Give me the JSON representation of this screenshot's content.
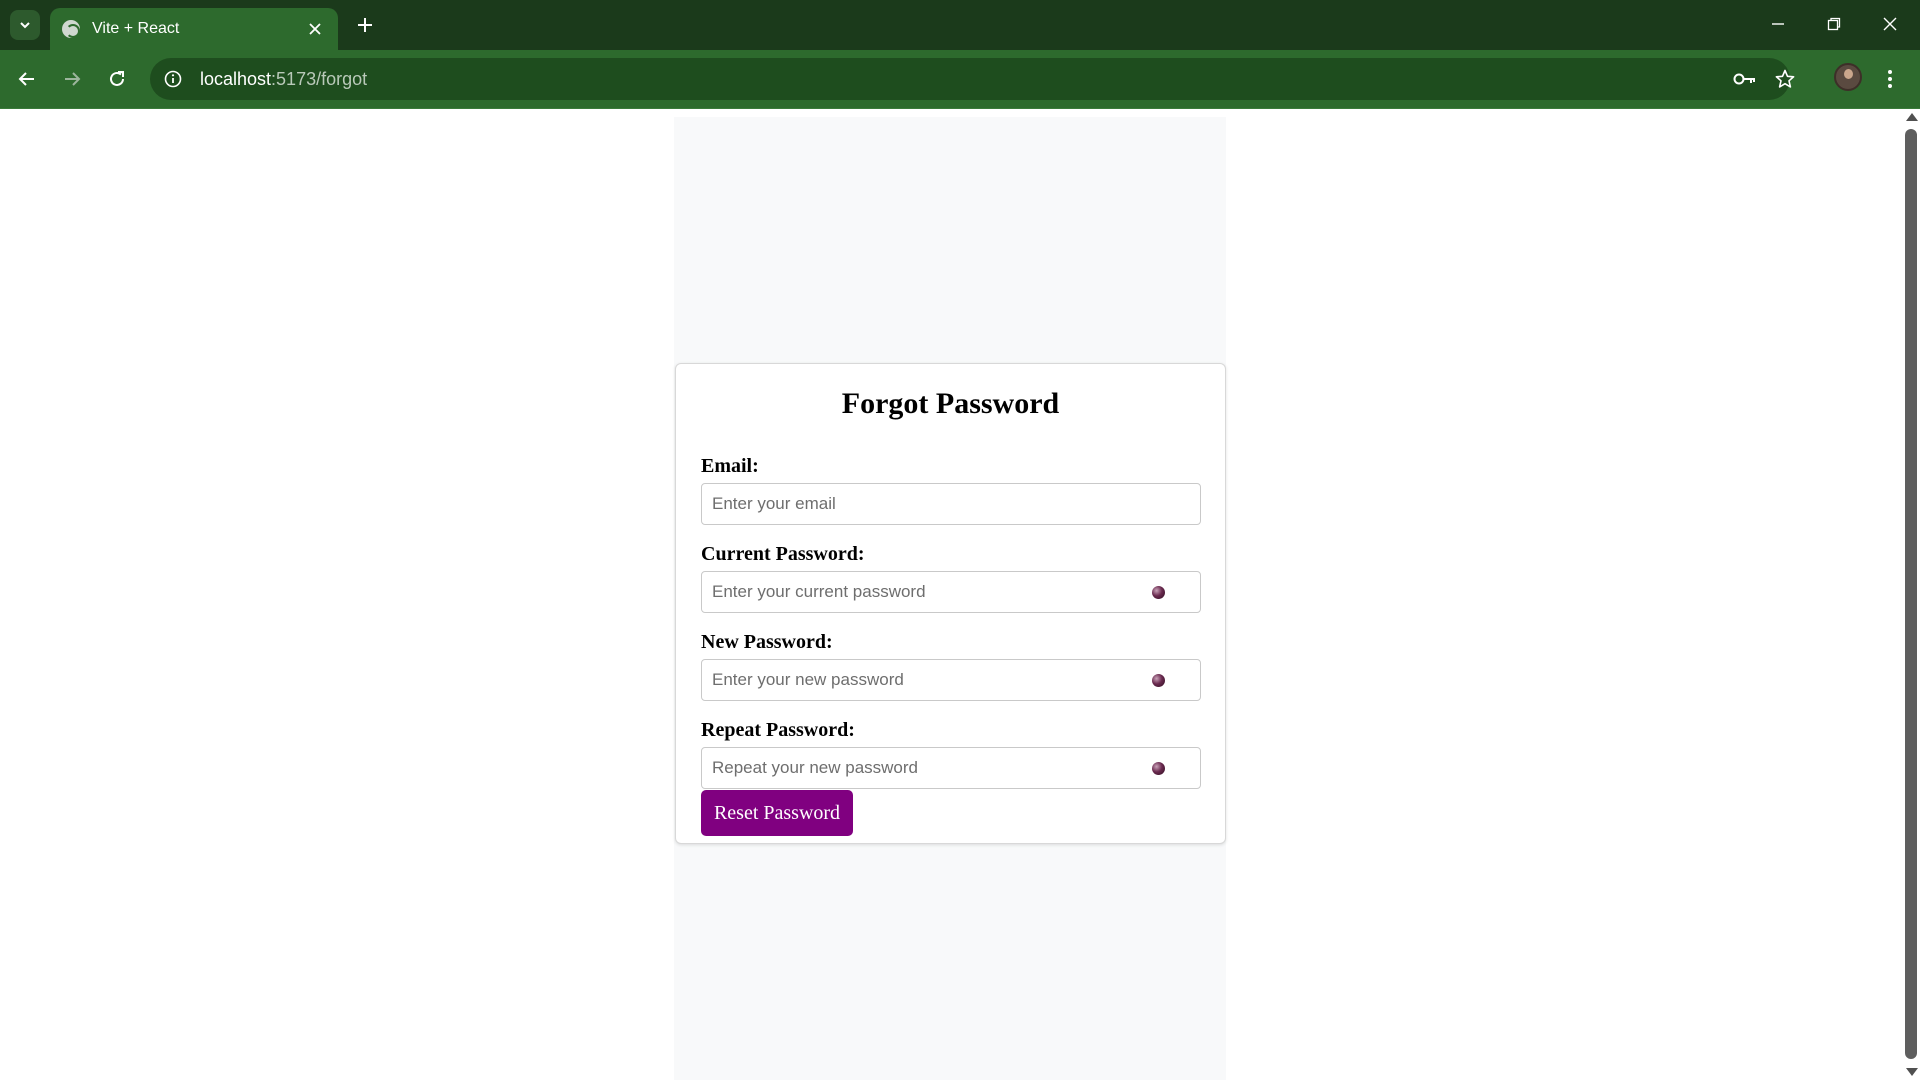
{
  "browser": {
    "tab_title": "Vite + React",
    "url_host": "localhost",
    "url_path": ":5173/forgot",
    "icons": {
      "tab_search": "chevron-down-icon",
      "favicon": "globe-icon",
      "tab_close": "close-icon",
      "new_tab": "plus-icon",
      "minimize": "minimize-icon",
      "restore": "restore-icon",
      "close": "close-icon",
      "back": "arrow-left-icon",
      "forward": "arrow-right-icon",
      "reload": "reload-icon",
      "site_info": "info-icon",
      "password_key": "key-icon",
      "bookmark": "star-icon",
      "profile": "avatar",
      "menu": "kebab-menu-icon"
    },
    "colors": {
      "tabstrip": "#1b3a1b",
      "toolbar": "#2d6a2d",
      "omnibox": "#1e4d1e"
    }
  },
  "form": {
    "title": "Forgot Password",
    "email_label": "Email:",
    "email_placeholder": "Enter your email",
    "current_label": "Current Password:",
    "current_placeholder": "Enter your current password",
    "new_label": "New Password:",
    "new_placeholder": "Enter your new password",
    "repeat_label": "Repeat Password:",
    "repeat_placeholder": "Repeat your new password",
    "eye_icon": "eye-toggle-icon",
    "submit_label": "Reset Password",
    "submit_color": "#800080"
  }
}
